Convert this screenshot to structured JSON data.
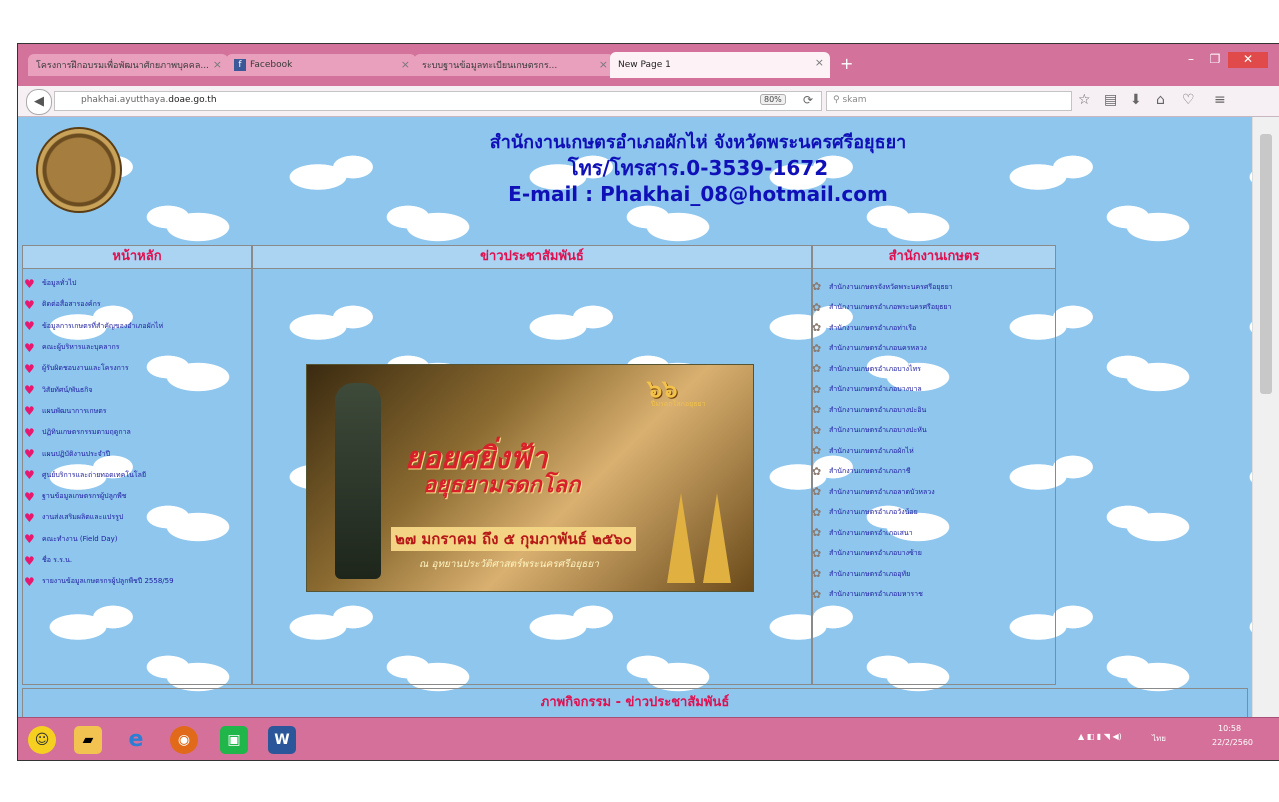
{
  "browser": {
    "tabs": [
      {
        "title": "โครงการฝึกอบรมเพื่อพัฒนาศักยภาพบุคคล...",
        "active": false
      },
      {
        "title": "Facebook",
        "active": false
      },
      {
        "title": "ระบบฐานข้อมูลทะเบียนเกษตรกร...",
        "active": false
      },
      {
        "title": "New Page 1",
        "active": true
      }
    ],
    "new_tab": "+",
    "url_prefix": "phakhai.ayutthaya.",
    "url_domain": "doae.go.th",
    "zoom": "80%",
    "search_placeholder": "skam",
    "window_controls": {
      "minimize": "–",
      "maximize": "❐",
      "close": "✕"
    }
  },
  "page": {
    "header": {
      "line1": "สำนักงานเกษตรอำเภอผักไห่ จังหวัดพระนครศรีอยุธยา",
      "line2": "โทร/โทรสาร.0-3539-1672",
      "line3": "E-mail : Phakhai_08@hotmail.com"
    },
    "columns": {
      "left": "หน้าหลัก",
      "center": "ข่าวประชาสัมพันธ์",
      "right": "สำนักงานเกษตร"
    },
    "menu": [
      "ข้อมูลทั่วไป",
      "ติดต่อสื่อสารองค์กร",
      "ข้อมูลการเกษตรที่สำคัญของอำเภอผักไห่",
      "คณะผู้บริหารและบุคลากร",
      "ผู้รับผิดชอบงานและโครงการ",
      "วิสัยทัศน์/พันธกิจ",
      "แผนพัฒนาการเกษตร",
      "ปฏิทินเกษตรกรรมตามฤดูกาล",
      "แผนปฏิบัติงานประจำปี",
      "ศูนย์บริการและถ่ายทอดเทคโนโลยี",
      "ฐานข้อมูลเกษตรกรผู้ปลูกพืช",
      "งานส่งเสริมผลิตและแปรรูป",
      "คณะทำงาน (Field Day)",
      "ชื่อ ร.ร.น.",
      "รายงานข้อมูลเกษตรกรผู้ปลูกพืชปี 2558/59"
    ],
    "offices": [
      "สำนักงานเกษตรจังหวัดพระนครศรีอยุธยา",
      "สำนักงานเกษตรอำเภอพระนครศรีอยุธยา",
      "สำนักงานเกษตรอำเภอท่าเรือ",
      "สำนักงานเกษตรอำเภอนครหลวง",
      "สำนักงานเกษตรอำเภอบางไทร",
      "สำนักงานเกษตรอำเภอบางบาล",
      "สำนักงานเกษตรอำเภอบางปะอิน",
      "สำนักงานเกษตรอำเภอบางปะหัน",
      "สำนักงานเกษตรอำเภอผักไห่",
      "สำนักงานเกษตรอำเภอภาชี",
      "สำนักงานเกษตรอำเภอลาดบัวหลวง",
      "สำนักงานเกษตรอำเภอวังน้อย",
      "สำนักงานเกษตรอำเภอเสนา",
      "สำนักงานเกษตรอำเภอบางซ้าย",
      "สำนักงานเกษตรอำเภออุทัย",
      "สำนักงานเกษตรอำเภอมหาราช"
    ],
    "banner": {
      "title": "ยอยศยิ่งฟ้า",
      "subtitle": "อยุธยามรดกโลก",
      "dates": "๒๗ มกราคม ถึง ๕ กุมภาพันธ์ ๒๕๖๐",
      "venue": "ณ อุทยานประวัติศาสตร์พระนครศรีอยุธยา",
      "logo": "๖๖",
      "logo_sub": "ปีมรดกโลกอยุธยา"
    },
    "activity_header": "ภาพกิจกรรม - ข่าวประชาสัมพันธ์"
  },
  "taskbar": {
    "apps": [
      "smiley",
      "file-explorer",
      "internet-explorer",
      "firefox",
      "line",
      "word"
    ],
    "time": "10:58",
    "date": "22/2/2560",
    "lang": "ไทย"
  }
}
